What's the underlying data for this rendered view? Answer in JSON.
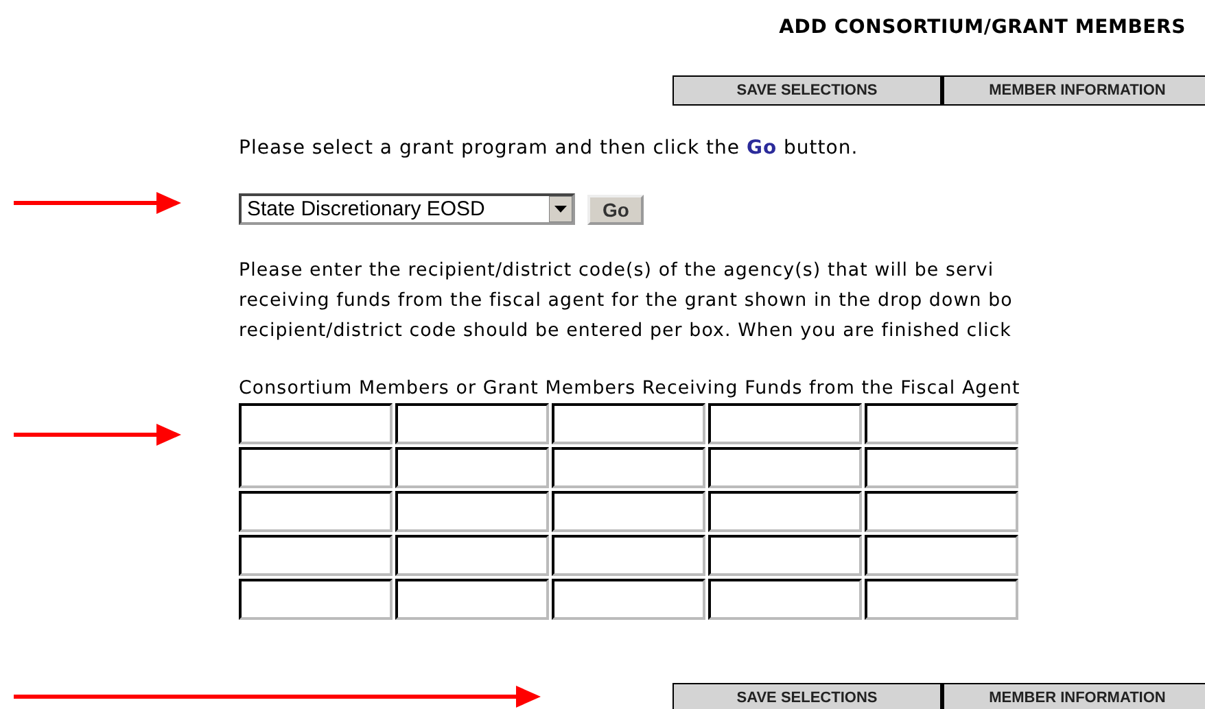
{
  "page_title": "ADD CONSORTIUM/GRANT MEMBERS",
  "top_buttons": [
    "SAVE SELECTIONS",
    "MEMBER INFORMATION"
  ],
  "instruction": "Please select a grant program and then click the **Go** button.",
  "grant_program": {
    "value": "State Discretionary EOSD"
  },
  "go_button": "Go",
  "paragraph_lines": [
    "Please enter the recipient/district code(s) of the agency(s) that will be servi",
    "receiving funds from the fiscal agent for the grant shown in the drop down bo",
    "recipient/district code should be entered per box. When you are finished click"
  ],
  "members_label": "Consortium Members or Grant Members Receiving Funds from the Fiscal Agent",
  "bottom_buttons": [
    "SAVE SELECTIONS",
    "MEMBER INFORMATION"
  ]
}
